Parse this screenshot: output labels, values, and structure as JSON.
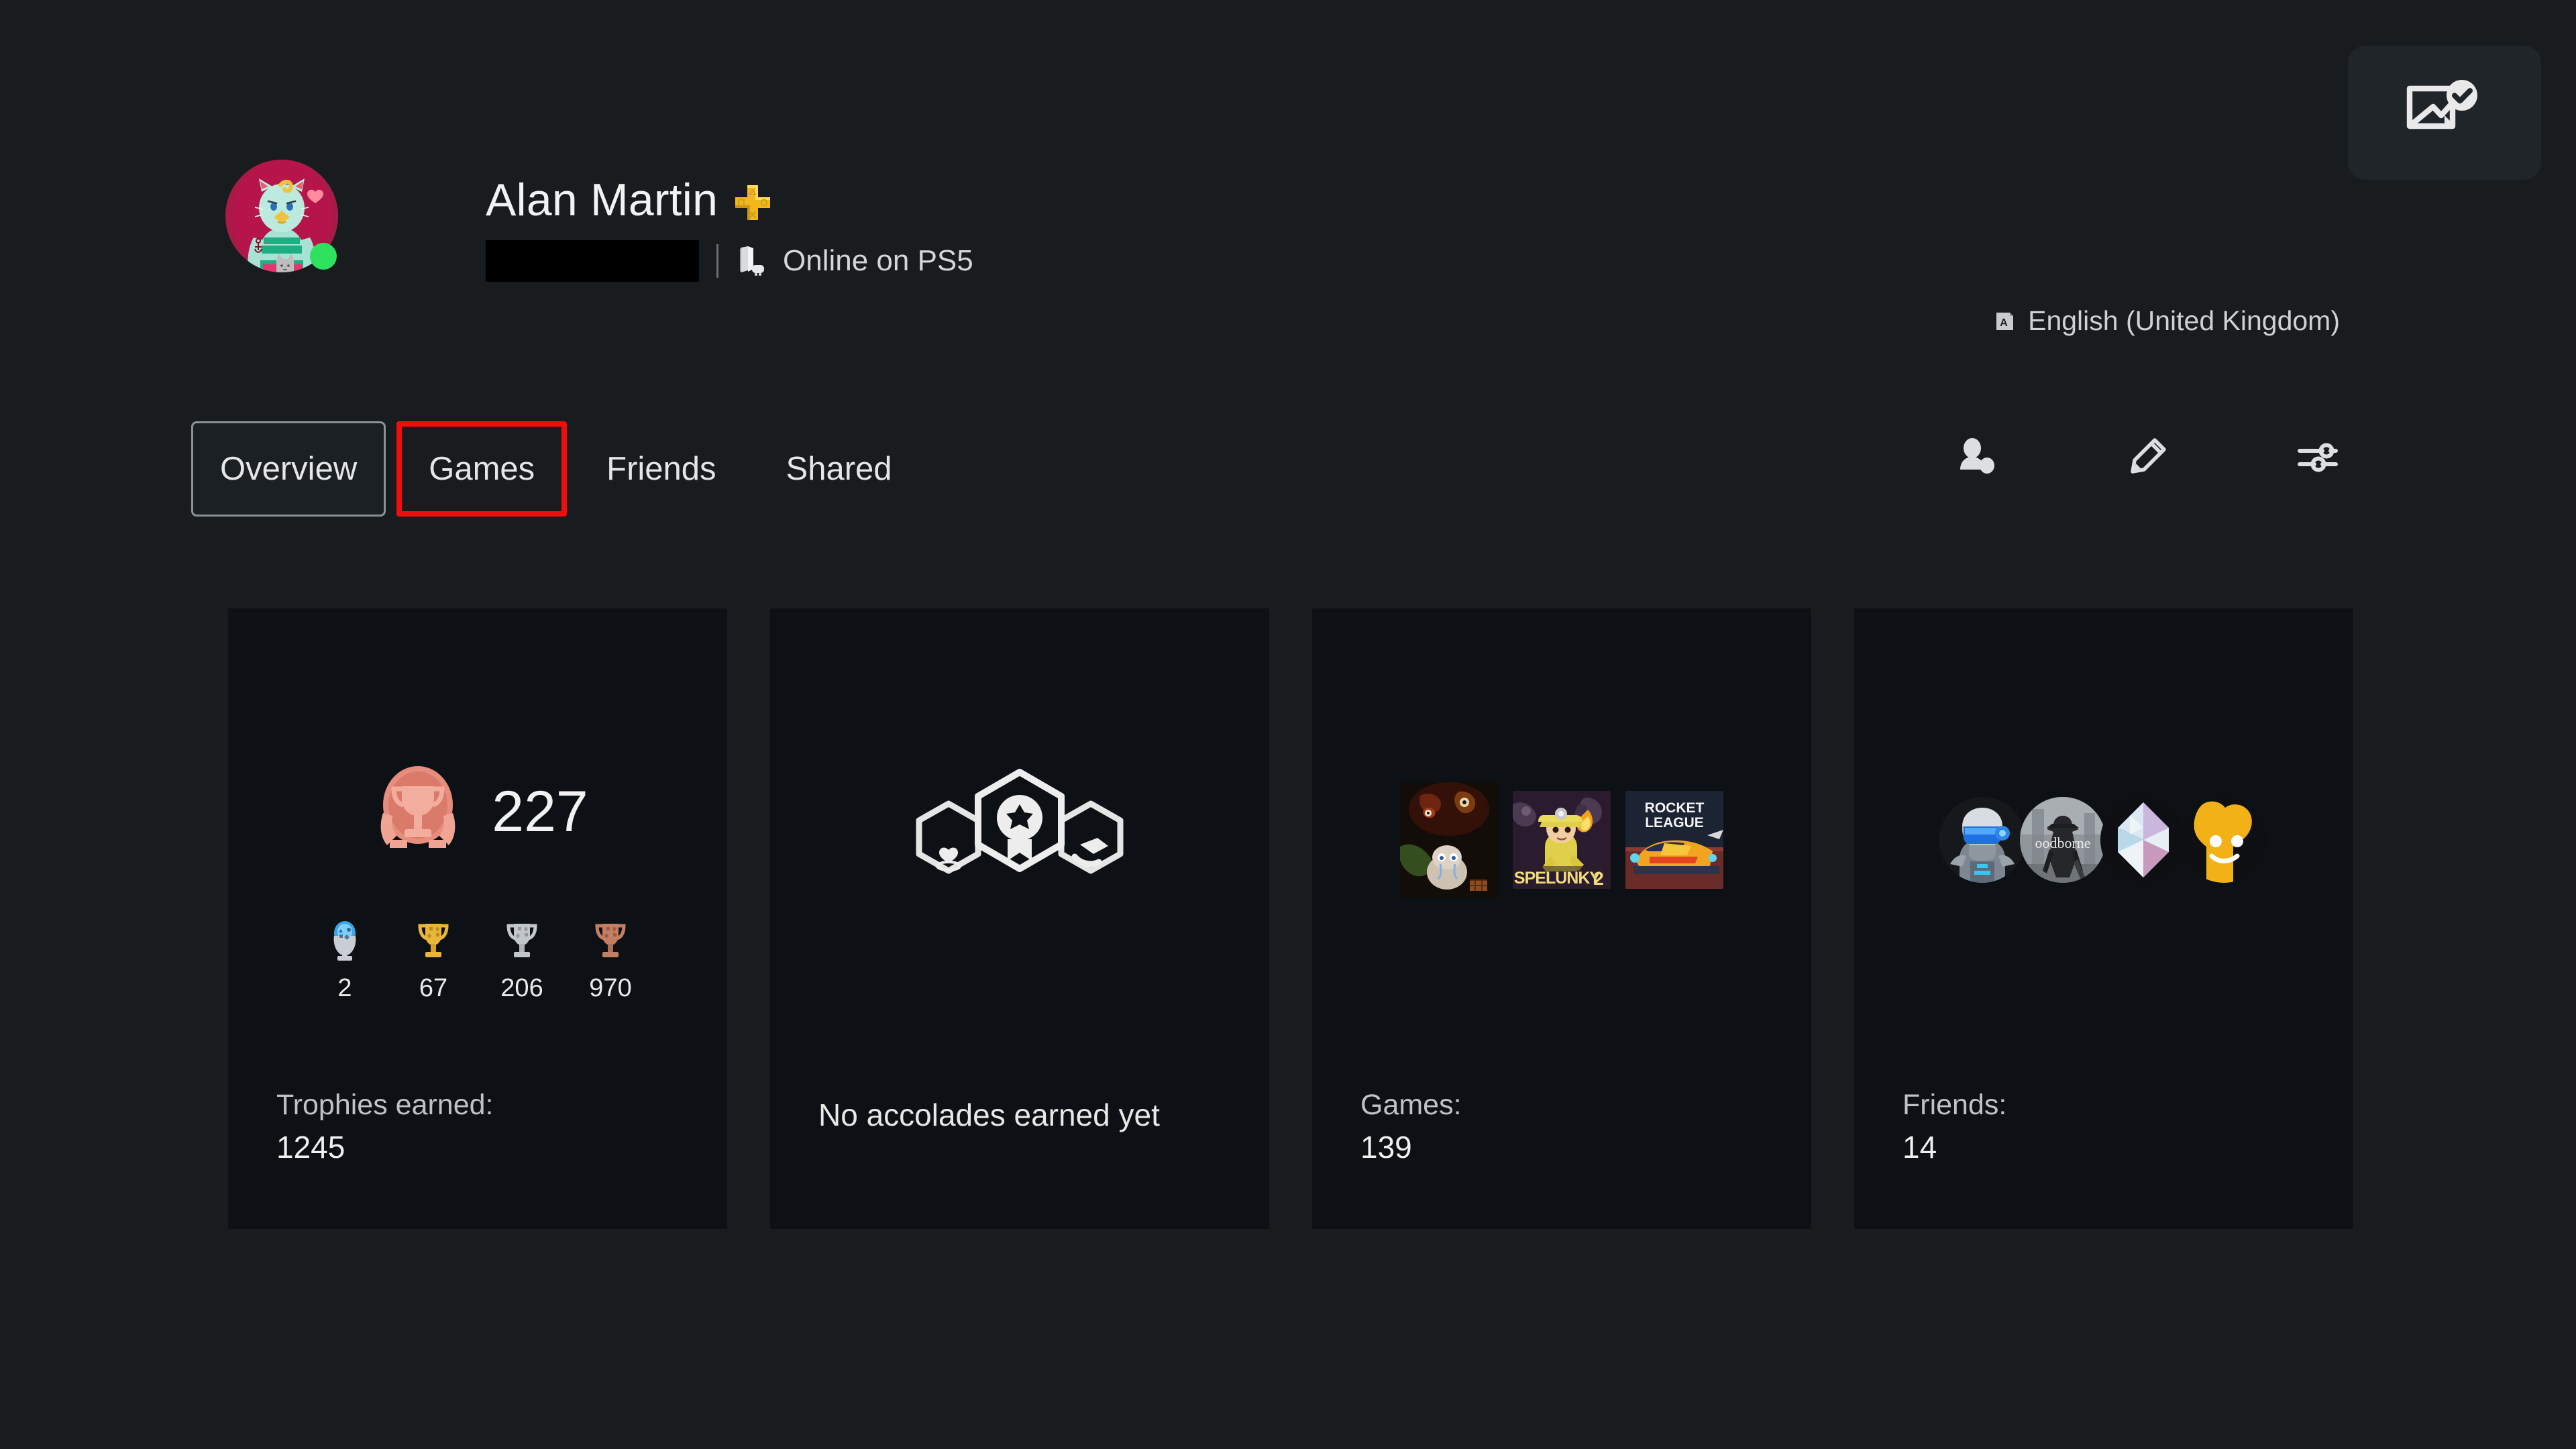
{
  "toast": {
    "icon": "image-saved-icon"
  },
  "profile": {
    "display_name": "Alan Martin",
    "plus_badge": "ps-plus-icon",
    "online_id_redacted": "",
    "status_text": "Online on PS5",
    "device_icon": "ps5-console-icon",
    "presence": "online",
    "avatar_icon": "cat-avatar"
  },
  "language": {
    "icon": "language-icon",
    "label": "English (United Kingdom)"
  },
  "tabs": [
    {
      "label": "Overview",
      "state": "selected"
    },
    {
      "label": "Games",
      "state": "annotated"
    },
    {
      "label": "Friends",
      "state": "normal"
    },
    {
      "label": "Shared",
      "state": "normal"
    }
  ],
  "header_actions": [
    {
      "name": "add-friend-icon"
    },
    {
      "name": "edit-profile-icon"
    },
    {
      "name": "profile-options-icon"
    }
  ],
  "cards": {
    "trophies": {
      "level": "227",
      "label": "Trophies earned:",
      "value": "1245",
      "breakdown": [
        {
          "type": "platinum",
          "count": "2"
        },
        {
          "type": "gold",
          "count": "67"
        },
        {
          "type": "silver",
          "count": "206"
        },
        {
          "type": "bronze",
          "count": "970"
        }
      ]
    },
    "accolades": {
      "label": "No accolades earned yet",
      "icons": [
        "heart-hexagon",
        "medal-hexagon",
        "helping-hand-hexagon"
      ]
    },
    "games": {
      "label": "Games:",
      "value": "139",
      "covers": [
        "the-binding-of-isaac",
        "spelunky-2",
        "rocket-league"
      ]
    },
    "friends": {
      "label": "Friends:",
      "value": "14",
      "avatars": [
        "robot-avatar",
        "bloodborne-avatar",
        "crystal-avatar",
        "smiley-avatar"
      ]
    }
  },
  "colors": {
    "page_bg": "#181c1f",
    "card_bg": "#0d1014",
    "annotation": "#f20d0d",
    "online": "#2fe25e",
    "ps_plus": "#f2b71a"
  }
}
